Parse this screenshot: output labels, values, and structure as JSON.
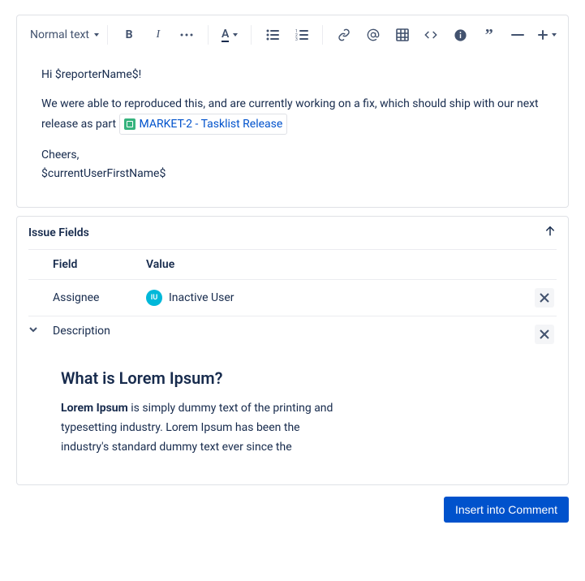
{
  "toolbar": {
    "text_style": "Normal text"
  },
  "editor": {
    "greeting": "Hi $reporterName$!",
    "body_before": "We were able to reproduced this, and are currently working on a fix, which should ship with our next release as part",
    "issue_key": "MARKET-2 - Tasklist Release",
    "signoff1": "Cheers,",
    "signoff2": "$currentUserFirstName$"
  },
  "fields": {
    "panel_title": "Issue Fields",
    "headers": {
      "field": "Field",
      "value": "Value"
    },
    "rows": [
      {
        "field": "Assignee",
        "avatar_initials": "IU",
        "value": "Inactive User"
      },
      {
        "field": "Description"
      }
    ],
    "description": {
      "heading": "What is Lorem Ipsum?",
      "bold_lead": "Lorem Ipsum",
      "text": " is simply dummy text of the printing and typesetting industry. Lorem Ipsum has been the industry's standard dummy text ever since the"
    }
  },
  "actions": {
    "insert": "Insert into Comment"
  }
}
